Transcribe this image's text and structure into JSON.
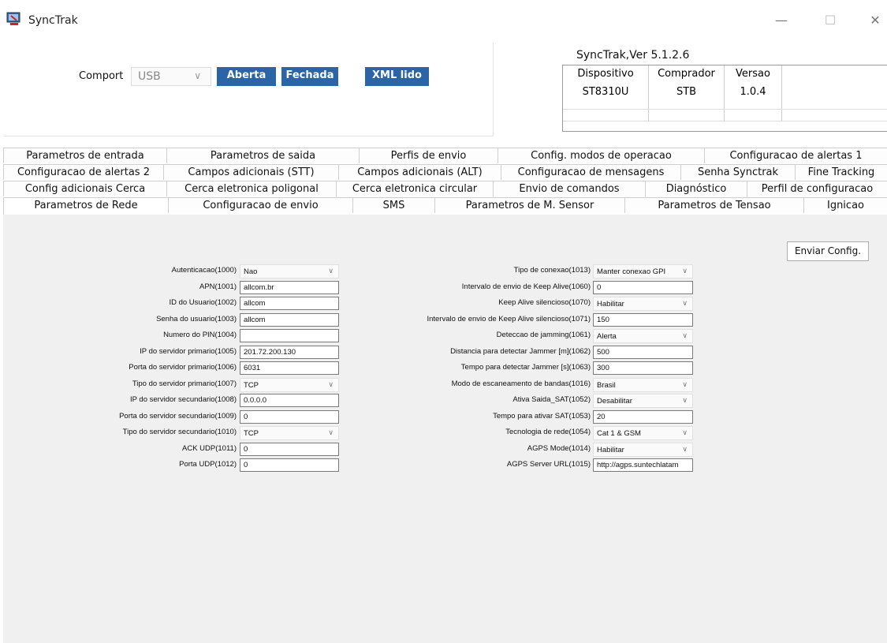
{
  "window": {
    "title": "SyncTrak",
    "minimize": "—",
    "maximize": "☐",
    "close": "✕"
  },
  "top": {
    "comport_label": "Comport",
    "comport_value": "USB",
    "btn_aberta": "Aberta",
    "btn_fechada": "Fechada",
    "btn_xml": "XML lido",
    "version_title": "SyncTrak,Ver 5.1.2.6",
    "version_table": {
      "headers": [
        "Dispositivo",
        "Comprador",
        "Versao"
      ],
      "values": [
        "ST8310U",
        "STB",
        "1.0.4"
      ]
    }
  },
  "tabs": {
    "row1": [
      "Parametros de entrada",
      "Parametros de saida",
      "Perfis de envio",
      "Config. modos de operacao",
      "Configuracao de alertas 1"
    ],
    "row2": [
      "Configuracao de alertas 2",
      "Campos adicionais (STT)",
      "Campos adicionais (ALT)",
      "Configuracao de mensagens",
      "Senha Synctrak",
      "Fine Tracking"
    ],
    "row3": [
      "Config adicionais Cerca",
      "Cerca eletronica poligonal",
      "Cerca eletronica circular",
      "Envio de comandos",
      "Diagnóstico",
      "Perfil de configuracao"
    ],
    "row4": [
      "Parametros de Rede",
      "Configuracao de envio",
      "SMS",
      "Parametros de M. Sensor",
      "Parametros de Tensao",
      "Ignicao"
    ]
  },
  "send_button": "Enviar Config.",
  "left_fields": [
    {
      "label": "Autenticacao(1000)",
      "value": "Nao",
      "kind": "combo"
    },
    {
      "label": "APN(1001)",
      "value": "allcom.br",
      "kind": "text"
    },
    {
      "label": "ID do Usuario(1002)",
      "value": "allcom",
      "kind": "text"
    },
    {
      "label": "Senha do usuario(1003)",
      "value": "allcom",
      "kind": "text"
    },
    {
      "label": "Numero do PIN(1004)",
      "value": "",
      "kind": "text"
    },
    {
      "label": "IP do servidor primario(1005)",
      "value": "201.72.200.130",
      "kind": "text"
    },
    {
      "label": "Porta do servidor primario(1006)",
      "value": "6031",
      "kind": "text"
    },
    {
      "label": "Tipo do servidor primario(1007)",
      "value": "TCP",
      "kind": "combo"
    },
    {
      "label": "IP do servidor secundario(1008)",
      "value": "0.0.0.0",
      "kind": "text"
    },
    {
      "label": "Porta do servidor secundario(1009)",
      "value": "0",
      "kind": "text"
    },
    {
      "label": "Tipo do servidor secundario(1010)",
      "value": "TCP",
      "kind": "combo"
    },
    {
      "label": "ACK UDP(1011)",
      "value": "0",
      "kind": "text"
    },
    {
      "label": "Porta UDP(1012)",
      "value": "0",
      "kind": "text"
    }
  ],
  "right_fields": [
    {
      "label": "Tipo de conexao(1013)",
      "value": "Manter conexao GPI",
      "kind": "combo"
    },
    {
      "label": "Intervalo de envio de Keep Alive(1060)",
      "value": "0",
      "kind": "text"
    },
    {
      "label": "Keep Alive silencioso(1070)",
      "value": "Habilitar",
      "kind": "combo"
    },
    {
      "label": "Intervalo de envio de Keep Alive silencioso(1071)",
      "value": "150",
      "kind": "text"
    },
    {
      "label": "Deteccao de jamming(1061)",
      "value": "Alerta",
      "kind": "combo"
    },
    {
      "label": "Distancia para detectar Jammer [m](1062)",
      "value": "500",
      "kind": "text"
    },
    {
      "label": "Tempo para detectar Jammer [s](1063)",
      "value": "300",
      "kind": "text"
    },
    {
      "label": "Modo de escaneamento de bandas(1016)",
      "value": "Brasil",
      "kind": "combo"
    },
    {
      "label": "Ativa Saida_SAT(1052)",
      "value": "Desabilitar",
      "kind": "combo"
    },
    {
      "label": "Tempo para ativar SAT(1053)",
      "value": "20",
      "kind": "text"
    },
    {
      "label": "Tecnologia de rede(1054)",
      "value": "Cat 1 & GSM",
      "kind": "combo"
    },
    {
      "label": "AGPS Mode(1014)",
      "value": "Habilitar",
      "kind": "combo"
    },
    {
      "label": "AGPS Server URL(1015)",
      "value": "http://agps.suntechlatam",
      "kind": "text"
    }
  ]
}
